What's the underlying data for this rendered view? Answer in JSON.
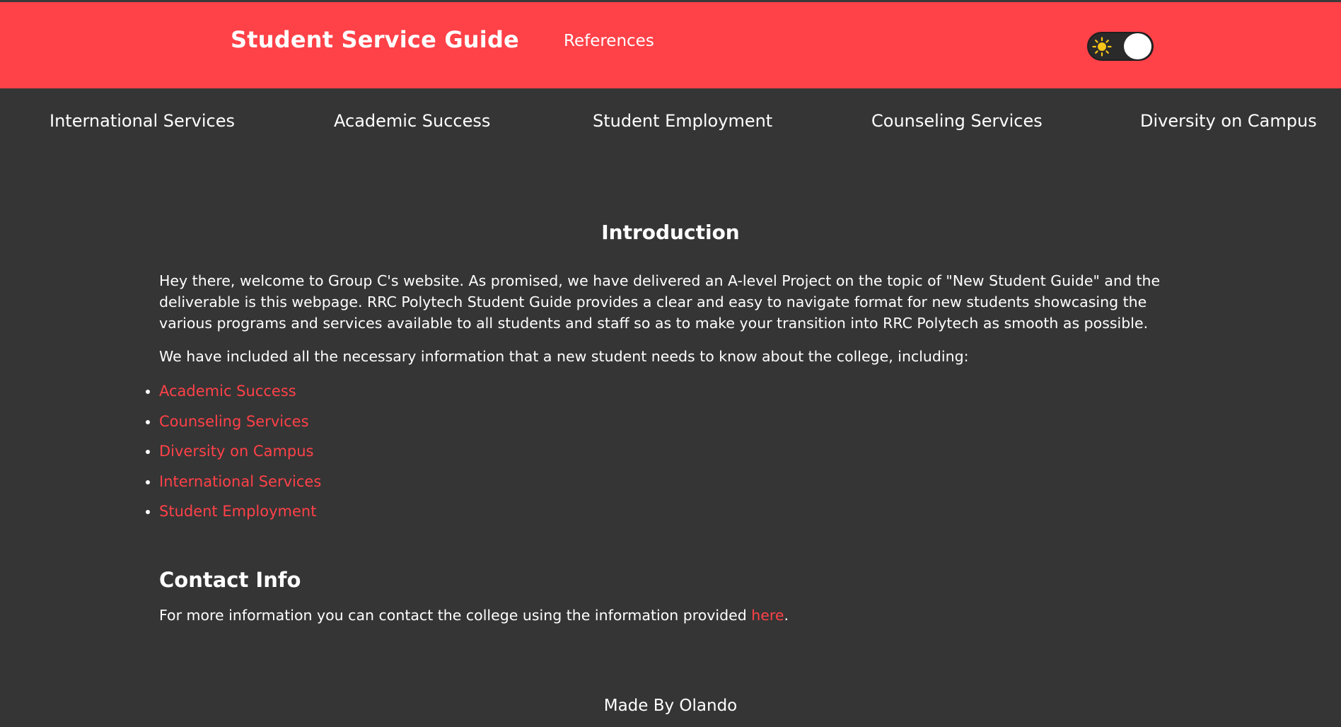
{
  "header": {
    "title": "Student Service Guide",
    "references_link": "References",
    "theme_toggle_icon": "sun-icon",
    "accent_color": "#ff4148"
  },
  "nav": {
    "items": [
      {
        "label": "International Services"
      },
      {
        "label": "Academic Success"
      },
      {
        "label": "Student Employment"
      },
      {
        "label": "Counseling Services"
      },
      {
        "label": "Diversity on Campus"
      }
    ]
  },
  "intro": {
    "heading": "Introduction",
    "paragraph1": "Hey there, welcome to Group C's website. As promised, we have delivered an A-level Project on the topic of \"New Student Guide\" and the deliverable is this webpage. RRC Polytech Student Guide provides a clear and easy to navigate format for new students showcasing the various programs and services available to all students and staff so as to make your transition into RRC Polytech as smooth as possible.",
    "paragraph2": "We have included all the necessary information that a new student needs to know about the college, including:",
    "list": [
      {
        "label": "Academic Success"
      },
      {
        "label": "Counseling Services"
      },
      {
        "label": "Diversity on Campus"
      },
      {
        "label": "International Services"
      },
      {
        "label": "Student Employment"
      }
    ]
  },
  "contact": {
    "heading": "Contact Info",
    "text_before": "For more information you can contact the college using the information provided ",
    "link_text": "here",
    "text_after": "."
  },
  "footer": {
    "text": "Made By Olando"
  }
}
